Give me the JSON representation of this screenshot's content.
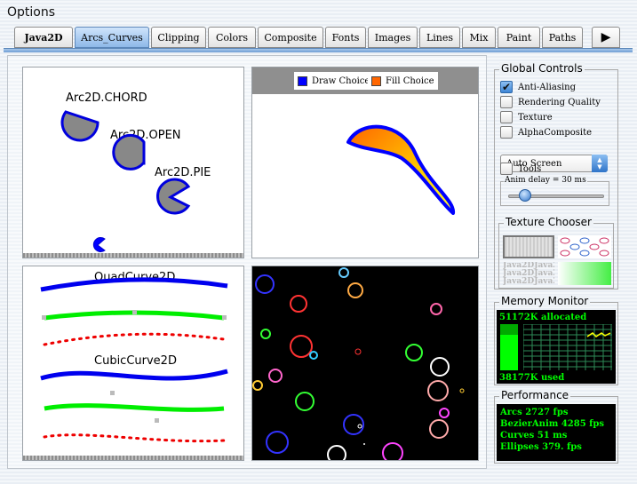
{
  "window": {
    "title": "Options"
  },
  "tabs": [
    {
      "label": "Java2D"
    },
    {
      "label": "Arcs_Curves"
    },
    {
      "label": "Clipping"
    },
    {
      "label": "Colors"
    },
    {
      "label": "Composite"
    },
    {
      "label": "Fonts"
    },
    {
      "label": "Images"
    },
    {
      "label": "Lines"
    },
    {
      "label": "Mix"
    },
    {
      "label": "Paint"
    },
    {
      "label": "Paths"
    }
  ],
  "tab_more_glyph": "▶",
  "active_tab": "Arcs_Curves",
  "arcs": {
    "chord": "Arc2D.CHORD",
    "open": "Arc2D.OPEN",
    "pie": "Arc2D.PIE"
  },
  "bezier": {
    "draw_choice": "Draw Choice",
    "fill_choice": "Fill Choice",
    "draw_color": "#0000ff",
    "fill_color": "#ff6600"
  },
  "curves": {
    "quad": "QuadCurve2D",
    "cubic": "CubicCurve2D"
  },
  "global_controls": {
    "title": "Global Controls",
    "anti_aliasing": "Anti-Aliasing",
    "anti_aliasing_checked": true,
    "rendering_quality": "Rendering Quality",
    "texture": "Texture",
    "alpha_composite": "AlphaComposite",
    "screen_select": "Auto Screen",
    "tools": "Tools",
    "anim_delay": "Anim delay = 30 ms"
  },
  "texture_chooser": {
    "title": "Texture Chooser",
    "sample_text": "Java2DJava2D"
  },
  "memory_monitor": {
    "title": "Memory Monitor",
    "allocated": "51172K allocated",
    "used": "38177K used"
  },
  "performance": {
    "title": "Performance",
    "lines": [
      "Arcs 2727 fps",
      "BezierAnim 4285 fps",
      "Curves 51 ms",
      "Ellipses 379. fps"
    ]
  },
  "colors": {
    "accent": "#3e86d6",
    "terminal_green": "#00ff00",
    "curve_blue": "#0000ff",
    "curve_green": "#00ff00",
    "curve_red": "#ff0000"
  }
}
